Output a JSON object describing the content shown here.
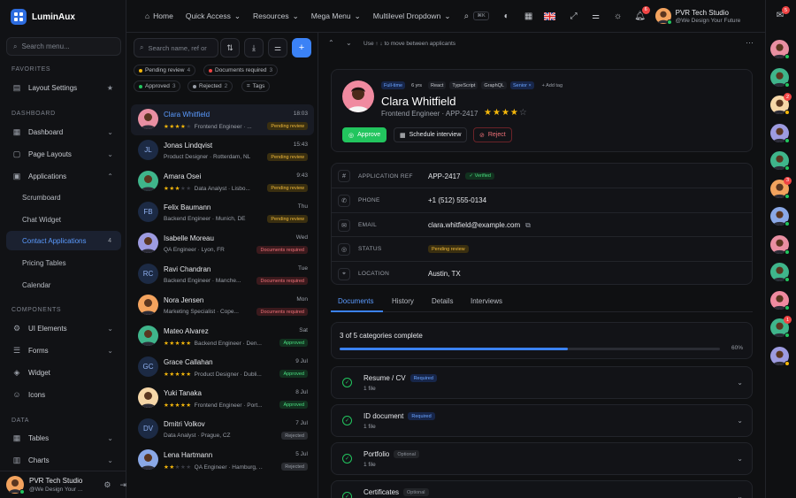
{
  "app": {
    "name": "LuminAux"
  },
  "sidebar": {
    "search_placeholder": "Search menu...",
    "sections": {
      "favorites": "FAVORITES",
      "dashboard": "DASHBOARD",
      "components": "COMPONENTS",
      "data": "DATA"
    },
    "items": {
      "layout_settings": "Layout Settings",
      "dashboard": "Dashboard",
      "page_layouts": "Page Layouts",
      "applications": "Applications",
      "scrumboard": "Scrumboard",
      "chat_widget": "Chat Widget",
      "contact_applications": "Contact Applications",
      "contact_applications_count": "4",
      "pricing_tables": "Pricing Tables",
      "calendar": "Calendar",
      "ui_elements": "UI Elements",
      "forms": "Forms",
      "widget": "Widget",
      "icons": "Icons",
      "tables": "Tables",
      "charts": "Charts"
    },
    "user": {
      "name": "PVR Tech Studio",
      "tagline": "@We Design Your ..."
    }
  },
  "topbar": {
    "home": "Home",
    "quick_access": "Quick Access",
    "resources": "Resources",
    "mega_menu": "Mega Menu",
    "multilevel": "Multilevel Dropdown",
    "kbd": "⌘K",
    "notification_count": "6",
    "user_name": "PVR Tech Studio",
    "user_tagline": "@We Design Your Future",
    "chat_count": "5"
  },
  "list": {
    "search_placeholder": "Search name, ref or role",
    "filters": [
      {
        "label": "Pending review",
        "count": "4",
        "color": "#f5b70b"
      },
      {
        "label": "Documents required",
        "count": "3",
        "color": "#ef4444"
      },
      {
        "label": "Approved",
        "count": "3",
        "color": "#22c55e"
      },
      {
        "label": "Rejected",
        "count": "2",
        "color": "#9a9fa8"
      },
      {
        "label": "Tags",
        "count": "",
        "color": ""
      }
    ],
    "rows": [
      {
        "name": "Clara Whitfield",
        "time": "18:03",
        "stars": "★★★★",
        "sub": "Frontend Engineer · ...",
        "status": "Pending review",
        "st": "pending",
        "initials": "",
        "bg": "#e98fa2"
      },
      {
        "name": "Jonas Lindqvist",
        "time": "15:43",
        "stars": "",
        "sub": "Product Designer · Rotterdam, NL",
        "status": "Pending review",
        "st": "pending",
        "initials": "JL",
        "bg": "#1c2a44"
      },
      {
        "name": "Amara Osei",
        "time": "9:43",
        "stars": "★★★",
        "sub": "Data Analyst · Lisbo...",
        "status": "Pending review",
        "st": "pending",
        "initials": "",
        "bg": "#3fb58b"
      },
      {
        "name": "Felix Baumann",
        "time": "Thu",
        "stars": "",
        "sub": "Backend Engineer · Munich, DE",
        "status": "Pending review",
        "st": "pending",
        "initials": "FB",
        "bg": "#1c2a44"
      },
      {
        "name": "Isabelle Moreau",
        "time": "Wed",
        "stars": "",
        "sub": "QA Engineer · Lyon, FR",
        "status": "Documents required",
        "st": "required",
        "initials": "",
        "bg": "#9d9be0"
      },
      {
        "name": "Ravi Chandran",
        "time": "Tue",
        "stars": "",
        "sub": "Backend Engineer · Manche...",
        "status": "Documents required",
        "st": "required",
        "initials": "RC",
        "bg": "#1c2a44"
      },
      {
        "name": "Nora Jensen",
        "time": "Mon",
        "stars": "",
        "sub": "Marketing Specialist · Cope...",
        "status": "Documents required",
        "st": "required",
        "initials": "",
        "bg": "#f3a35e"
      },
      {
        "name": "Mateo Alvarez",
        "time": "Sat",
        "stars": "★★★★★",
        "sub": "Backend Engineer · Den...",
        "status": "Approved",
        "st": "approved",
        "initials": "",
        "bg": "#3fb58b"
      },
      {
        "name": "Grace Callahan",
        "time": "9 Jul",
        "stars": "★★★★★",
        "sub": "Product Designer · Dubli...",
        "status": "Approved",
        "st": "approved",
        "initials": "GC",
        "bg": "#1c2a44"
      },
      {
        "name": "Yuki Tanaka",
        "time": "8 Jul",
        "stars": "★★★★★",
        "sub": "Frontend Engineer · Port...",
        "status": "Approved",
        "st": "approved",
        "initials": "",
        "bg": "#f6d7a8"
      },
      {
        "name": "Dmitri Volkov",
        "time": "7 Jul",
        "stars": "",
        "sub": "Data Analyst · Prague, CZ",
        "status": "Rejected",
        "st": "rejected",
        "initials": "DV",
        "bg": "#1c2a44"
      },
      {
        "name": "Lena Hartmann",
        "time": "5 Jul",
        "stars": "★★",
        "sub": "QA Engineer · Hamburg, ...",
        "status": "Rejected",
        "st": "rejected",
        "initials": "",
        "bg": "#8aa8e6"
      }
    ]
  },
  "detail": {
    "nav_hint": "Use ↑ ↓ to move between applicants",
    "tags": [
      "Full-time",
      "6 yrs",
      "React",
      "TypeScript",
      "GraphQL",
      "Senior"
    ],
    "add_tag": "+ Add tag",
    "name": "Clara Whitfield",
    "role": "Frontend Engineer · APP-2417",
    "rating": 4,
    "approve": "Approve",
    "schedule": "Schedule interview",
    "reject": "Reject",
    "fields": {
      "ref_label": "APPLICATION REF",
      "ref": "APP-2417",
      "verified": "Verified",
      "phone_label": "PHONE",
      "phone": "+1 (512) 555-0134",
      "email_label": "EMAIL",
      "email": "clara.whitfield@example.com",
      "status_label": "STATUS",
      "status": "Pending review",
      "location_label": "LOCATION",
      "location": "Austin, TX"
    },
    "tabs": [
      "Documents",
      "History",
      "Details",
      "Interviews"
    ],
    "progress": {
      "text": "3 of 5 categories complete",
      "percent": 60,
      "percent_label": "60%"
    },
    "docs": [
      {
        "title": "Resume / CV",
        "badge": "Required",
        "kind": "r",
        "files": "1 file"
      },
      {
        "title": "ID document",
        "badge": "Required",
        "kind": "r",
        "files": "1 file"
      },
      {
        "title": "Portfolio",
        "badge": "Optional",
        "kind": "o",
        "files": "1 file"
      },
      {
        "title": "Certificates",
        "badge": "Optional",
        "kind": "o",
        "files": ""
      }
    ]
  },
  "rail": {
    "badges": [
      "2",
      "3",
      "1"
    ]
  },
  "colors": {
    "accent": "#3b82f6",
    "success": "#22c55e",
    "warning": "#f5b70b",
    "danger": "#ef4444"
  }
}
